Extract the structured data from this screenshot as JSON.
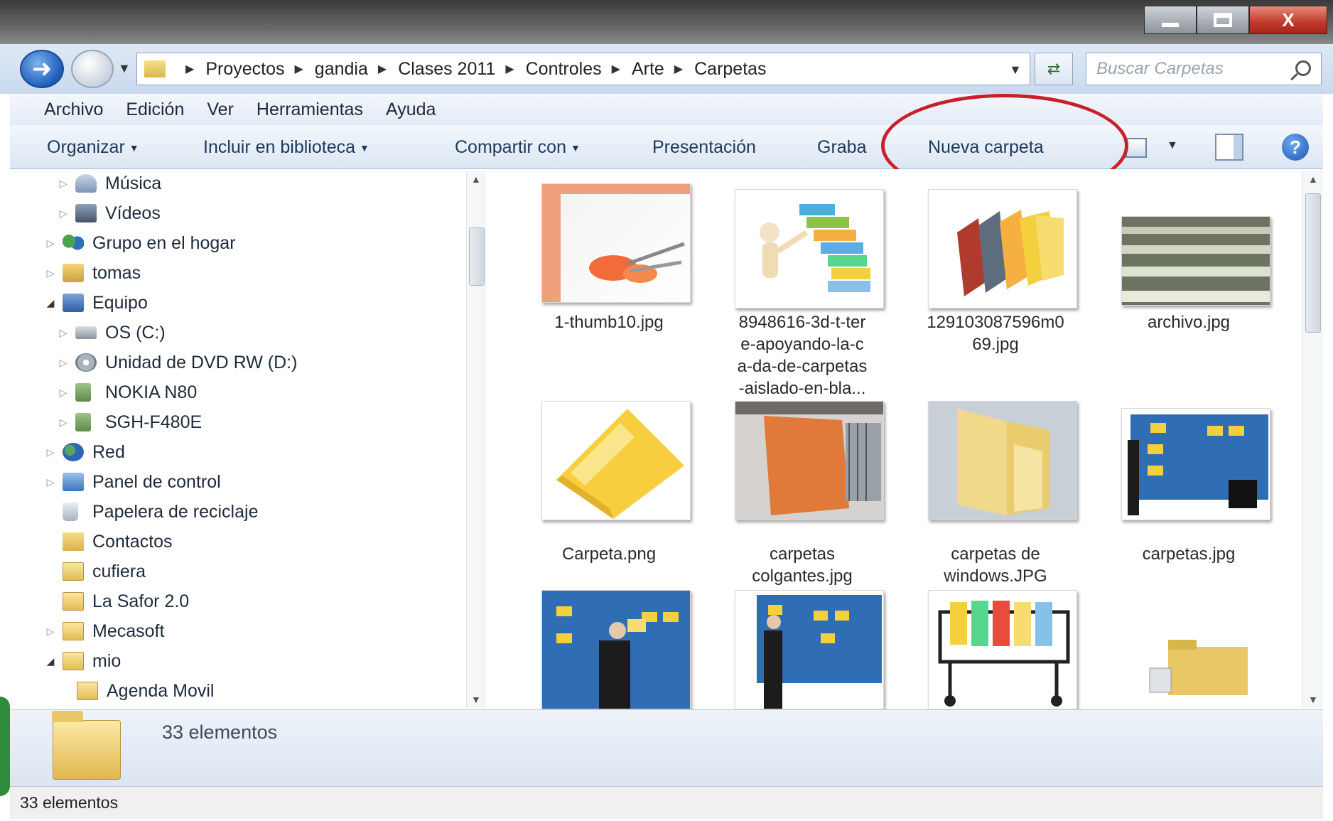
{
  "window": {
    "controls": {
      "minimize": "",
      "maximize": "",
      "close": "X"
    }
  },
  "address": {
    "breadcrumbs": [
      "Proyectos",
      "gandia",
      "Clases 2011",
      "Controles",
      "Arte",
      "Carpetas"
    ],
    "search_placeholder": "Buscar Carpetas"
  },
  "menu": [
    "Archivo",
    "Edición",
    "Ver",
    "Herramientas",
    "Ayuda"
  ],
  "toolbar": {
    "organize": "Organizar",
    "include_library": "Incluir en biblioteca",
    "share_with": "Compartir con",
    "slideshow": "Presentación",
    "burn": "Graba",
    "new_folder": "Nueva carpeta"
  },
  "nav_tree": [
    {
      "label": "Música",
      "icon": "music-icon"
    },
    {
      "label": "Vídeos",
      "icon": "video-icon"
    },
    {
      "label": "Grupo en el hogar",
      "icon": "homegroup-icon"
    },
    {
      "label": "tomas",
      "icon": "user-folder-icon"
    },
    {
      "label": "Equipo",
      "icon": "computer-icon"
    },
    {
      "label": "OS (C:)",
      "icon": "drive-icon"
    },
    {
      "label": "Unidad de DVD RW (D:)",
      "icon": "dvd-drive-icon"
    },
    {
      "label": "NOKIA N80",
      "icon": "phone-icon"
    },
    {
      "label": "SGH-F480E",
      "icon": "phone-icon"
    },
    {
      "label": "Red",
      "icon": "network-icon"
    },
    {
      "label": "Panel de control",
      "icon": "control-panel-icon"
    },
    {
      "label": "Papelera de reciclaje",
      "icon": "recycle-bin-icon"
    },
    {
      "label": "Contactos",
      "icon": "contacts-icon"
    },
    {
      "label": "cufiera",
      "icon": "folder-icon"
    },
    {
      "label": "La Safor 2.0",
      "icon": "folder-icon"
    },
    {
      "label": "Mecasoft",
      "icon": "folder-icon"
    },
    {
      "label": "mio",
      "icon": "folder-icon"
    },
    {
      "label": "Agenda Movil",
      "icon": "folder-icon"
    }
  ],
  "files": [
    {
      "name": "1-thumb10.jpg",
      "lines": [
        "1-thumb10.jpg"
      ]
    },
    {
      "name": "8948616-3d-t-ter e-apoyando-la-c a-da-de-carpetas -aislado-en-bla...",
      "lines": [
        "8948616-3d-t-ter",
        "e-apoyando-la-c",
        "a-da-de-carpetas",
        "-aislado-en-bla..."
      ]
    },
    {
      "name": "129103087596m0 69.jpg",
      "lines": [
        "129103087596m0",
        "69.jpg"
      ]
    },
    {
      "name": "archivo.jpg",
      "lines": [
        "archivo.jpg"
      ]
    },
    {
      "name": "Carpeta.png",
      "lines": [
        "Carpeta.png"
      ]
    },
    {
      "name": "carpetas colgantes.jpg",
      "lines": [
        "carpetas",
        "colgantes.jpg"
      ]
    },
    {
      "name": "carpetas de windows.JPG",
      "lines": [
        "carpetas de",
        "windows.JPG"
      ]
    },
    {
      "name": "carpetas.jpg",
      "lines": [
        "carpetas.jpg"
      ]
    },
    {
      "name": "",
      "lines": []
    },
    {
      "name": "",
      "lines": []
    },
    {
      "name": "",
      "lines": []
    },
    {
      "name": "",
      "lines": []
    }
  ],
  "details": {
    "count": "33 elementos"
  },
  "status": {
    "count": "33 elementos"
  },
  "colors": {
    "accent": "#1e395b",
    "highlight_ring": "#c8202a"
  }
}
